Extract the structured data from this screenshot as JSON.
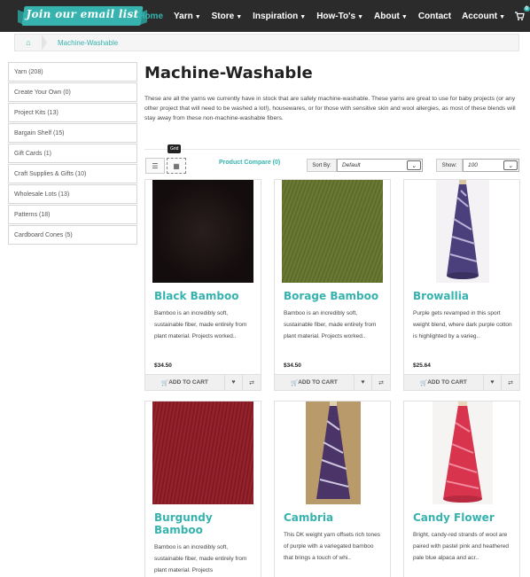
{
  "header": {
    "logo_text": "Join our email list",
    "nav": [
      {
        "label": "Home",
        "caret": false,
        "active": true
      },
      {
        "label": "Yarn",
        "caret": true
      },
      {
        "label": "Store",
        "caret": true
      },
      {
        "label": "Inspiration",
        "caret": true
      },
      {
        "label": "How-To's",
        "caret": true
      },
      {
        "label": "About",
        "caret": true
      },
      {
        "label": "Contact",
        "caret": false
      },
      {
        "label": "Account",
        "caret": true
      }
    ],
    "cart_count": "0",
    "accent": "#36b3ae",
    "bar_color": "#2b2b2b"
  },
  "breadcrumb": {
    "current": "Machine-Washable"
  },
  "sidebar": {
    "items": [
      {
        "label": "Yarn (208)"
      },
      {
        "label": "Create Your Own (0)"
      },
      {
        "label": "Project Kits (13)"
      },
      {
        "label": "Bargain Shelf (15)"
      },
      {
        "label": "Gift Cards (1)"
      },
      {
        "label": "Craft Supplies & Gifts (10)"
      },
      {
        "label": "Wholesale Lots (13)"
      },
      {
        "label": "Patterns (18)"
      },
      {
        "label": "Cardboard Cones (5)"
      }
    ]
  },
  "main": {
    "title": "Machine-Washable",
    "intro": "These are all the yarns we currently have in stock that are safely machine-washable.  These yarns are great to use for baby projects (or any other project that will need to be washed  a lot!), housewares, or for those with sensitive skin and wool allergies, as most of these blends will stay away from these non-machine-washable fibers.",
    "tooltip": "Grid",
    "compare_label": "Product Compare (0)",
    "sort_label": "Sort By:",
    "sort_value": "Default",
    "show_label": "Show:",
    "show_value": "100"
  },
  "products": [
    {
      "name": "Black Bamboo",
      "desc": "Bamboo is an incredibly soft, sustainable fiber, made entirely from plant material.  Projects worked..",
      "price": "$34.50",
      "add_label": "ADD TO CART",
      "image": "black-skein",
      "color": "#1a1212"
    },
    {
      "name": "Borage Bamboo",
      "desc": "Bamboo is an incredibly soft, sustainable fiber, made entirely from plant material.  Projects worked..",
      "price": "$34.50",
      "add_label": "ADD TO CART",
      "image": "green-skein",
      "color": "#5f6d2c"
    },
    {
      "name": "Browallia",
      "desc": "Purple gets revamped in this sport weight blend, where dark purple cotton is highlighted by a varieg..",
      "price": "$25.64",
      "add_label": "ADD TO CART",
      "image": "purple-cone",
      "color": "#4a3f7a"
    },
    {
      "name": "Burgundy Bamboo",
      "desc": "Bamboo is an incredibly soft, sustainable fiber, made entirely from plant material.  Projects",
      "price": "",
      "add_label": "",
      "image": "burgundy-skein",
      "color": "#8a1a24"
    },
    {
      "name": "Cambria",
      "desc": "This DK weight yarn offsets rich tones of purple with a variegated bamboo that brings a touch of whi..",
      "price": "",
      "add_label": "",
      "image": "purple-cone",
      "color": "#4b3568"
    },
    {
      "name": "Candy Flower",
      "desc": "Bright, candy-red strands of wool are paired with pastel pink and heathered pale blue alpaca and acr..",
      "price": "",
      "add_label": "",
      "image": "red-cone",
      "color": "#d8344e"
    }
  ]
}
